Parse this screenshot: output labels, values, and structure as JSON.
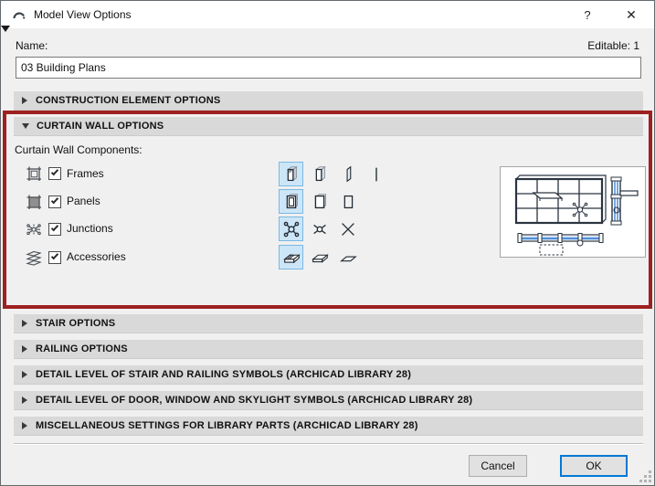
{
  "window": {
    "title": "Model View Options",
    "help_label": "?",
    "close_label": "✕"
  },
  "colors": {
    "dialog_bg": "#f0f0f0",
    "titlebar_bg": "#ffffff",
    "section_header_bg": "#d9d9d9",
    "annotation_red": "#9e2020",
    "selected_option_bg": "#cce6f7",
    "selected_option_border": "#7ab8e3",
    "ok_focus_border": "#0078d7",
    "preview_line_blue": "#1f6fd0"
  },
  "name_field": {
    "label": "Name:",
    "editable_info": "Editable: 1",
    "value": "03 Building Plans"
  },
  "sections": {
    "construction": {
      "label": "CONSTRUCTION ELEMENT OPTIONS",
      "expanded": false
    },
    "curtain_wall": {
      "label": "CURTAIN WALL OPTIONS",
      "expanded": true
    },
    "stair": {
      "label": "STAIR OPTIONS",
      "expanded": false
    },
    "railing": {
      "label": "RAILING OPTIONS",
      "expanded": false
    },
    "detail_stair_railing": {
      "label": "DETAIL LEVEL OF STAIR AND RAILING SYMBOLS (ARCHICAD LIBRARY 28)",
      "expanded": false
    },
    "detail_door_window": {
      "label": "DETAIL LEVEL OF DOOR, WINDOW AND SKYLIGHT SYMBOLS (ARCHICAD LIBRARY 28)",
      "expanded": false
    },
    "misc_library": {
      "label": "MISCELLANEOUS SETTINGS FOR LIBRARY PARTS (ARCHICAD LIBRARY 28)",
      "expanded": false
    }
  },
  "curtain_wall": {
    "components_label": "Curtain Wall Components:",
    "preview_icon": "curtain-wall-plan-preview",
    "rows": [
      {
        "label": "Frames",
        "checked": true,
        "icon": "frame-icon",
        "options": [
          "frames-detailed-3d",
          "frames-simplified-3d",
          "frames-planar",
          "frames-linear"
        ],
        "selected_index": 0
      },
      {
        "label": "Panels",
        "checked": true,
        "icon": "panel-icon",
        "options": [
          "panels-detailed-3d",
          "panels-simplified-3d",
          "panels-schematic"
        ],
        "selected_index": 0
      },
      {
        "label": "Junctions",
        "checked": true,
        "icon": "junction-icon",
        "options": [
          "junctions-detailed",
          "junctions-simplified",
          "junctions-schematic"
        ],
        "selected_index": 0
      },
      {
        "label": "Accessories",
        "checked": true,
        "icon": "accessory-icon",
        "options": [
          "accessories-detailed",
          "accessories-simplified",
          "accessories-schematic"
        ],
        "selected_index": 0
      }
    ]
  },
  "footer": {
    "cancel_label": "Cancel",
    "ok_label": "OK"
  }
}
